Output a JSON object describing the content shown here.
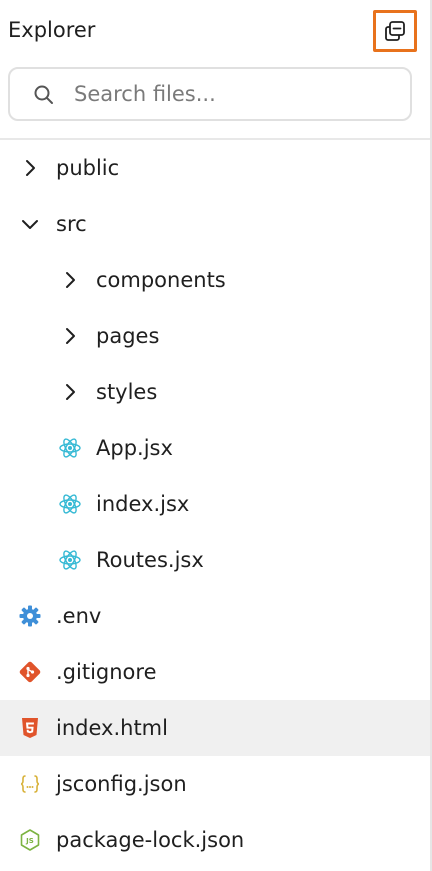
{
  "header": {
    "title": "Explorer",
    "collapse_icon": "collapse-all-icon"
  },
  "search": {
    "placeholder": "Search files...",
    "value": ""
  },
  "tree": [
    {
      "label": "public",
      "type": "folder",
      "expanded": false,
      "level": 0,
      "icon": "chevron-right-icon"
    },
    {
      "label": "src",
      "type": "folder",
      "expanded": true,
      "level": 0,
      "icon": "chevron-down-icon"
    },
    {
      "label": "components",
      "type": "folder",
      "expanded": false,
      "level": 1,
      "icon": "chevron-right-icon"
    },
    {
      "label": "pages",
      "type": "folder",
      "expanded": false,
      "level": 1,
      "icon": "chevron-right-icon"
    },
    {
      "label": "styles",
      "type": "folder",
      "expanded": false,
      "level": 1,
      "icon": "chevron-right-icon"
    },
    {
      "label": "App.jsx",
      "type": "file",
      "level": 1,
      "icon": "react-icon"
    },
    {
      "label": "index.jsx",
      "type": "file",
      "level": 1,
      "icon": "react-icon"
    },
    {
      "label": "Routes.jsx",
      "type": "file",
      "level": 1,
      "icon": "react-icon"
    },
    {
      "label": ".env",
      "type": "file",
      "level": 0,
      "icon": "gear-icon"
    },
    {
      "label": ".gitignore",
      "type": "file",
      "level": 0,
      "icon": "git-icon"
    },
    {
      "label": "index.html",
      "type": "file",
      "level": 0,
      "icon": "html5-icon",
      "selected": true
    },
    {
      "label": "jsconfig.json",
      "type": "file",
      "level": 0,
      "icon": "json-icon"
    },
    {
      "label": "package-lock.json",
      "type": "file",
      "level": 0,
      "icon": "nodejs-icon"
    }
  ],
  "colors": {
    "focus_outline": "#e8721c",
    "selected_row": "#f0f0f0",
    "react": "#35b9d4",
    "env": "#3f8fd8",
    "git": "#e0542b",
    "html": "#e0542b",
    "json": "#d8b23a",
    "node": "#7cb342"
  }
}
